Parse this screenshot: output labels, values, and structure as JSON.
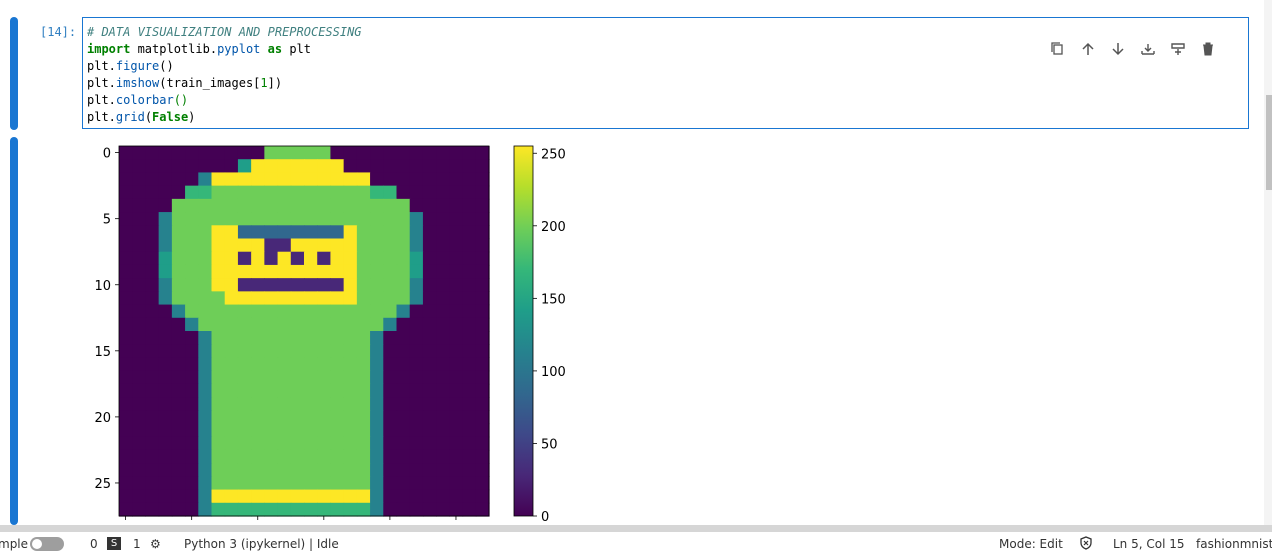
{
  "cell": {
    "prompt": "[14]:",
    "code": [
      [
        {
          "t": "# DATA VISUALIZATION AND PREPROCESSING",
          "c": "c-comment"
        }
      ],
      [
        {
          "t": "import",
          "c": "c-kw"
        },
        {
          "t": " matplotlib.",
          "c": "c-plain"
        },
        {
          "t": "pyplot",
          "c": "c-attr"
        },
        {
          "t": " ",
          "c": "c-plain"
        },
        {
          "t": "as",
          "c": "c-kw"
        },
        {
          "t": " plt",
          "c": "c-plain"
        }
      ],
      [
        {
          "t": "plt.",
          "c": "c-plain"
        },
        {
          "t": "figure",
          "c": "c-attr"
        },
        {
          "t": "()",
          "c": "c-plain"
        }
      ],
      [
        {
          "t": "plt.",
          "c": "c-plain"
        },
        {
          "t": "imshow",
          "c": "c-attr"
        },
        {
          "t": "(train_images[",
          "c": "c-plain"
        },
        {
          "t": "1",
          "c": "c-num"
        },
        {
          "t": "])",
          "c": "c-plain"
        }
      ],
      [
        {
          "t": "plt.",
          "c": "c-plain"
        },
        {
          "t": "colorbar",
          "c": "c-attr"
        },
        {
          "t": "()",
          "c": "c-num"
        }
      ],
      [
        {
          "t": "plt.",
          "c": "c-plain"
        },
        {
          "t": "grid",
          "c": "c-attr"
        },
        {
          "t": "(",
          "c": "c-plain"
        },
        {
          "t": "False",
          "c": "c-kw"
        },
        {
          "t": ")",
          "c": "c-plain"
        }
      ]
    ],
    "toolbar": [
      {
        "name": "copy-cell-icon"
      },
      {
        "name": "move-up-icon"
      },
      {
        "name": "move-down-icon"
      },
      {
        "name": "insert-above-icon"
      },
      {
        "name": "insert-below-icon"
      },
      {
        "name": "delete-cell-icon"
      }
    ]
  },
  "chart_data": {
    "type": "heatmap",
    "title": "",
    "xlabel": "",
    "ylabel": "",
    "y_ticks": [
      "0",
      "5",
      "10",
      "15",
      "20",
      "25"
    ],
    "colorbar_ticks": [
      "250",
      "200",
      "150",
      "100",
      "50",
      "0"
    ],
    "colorbar_range": [
      0,
      255
    ],
    "colormap": "viridis",
    "grid": false,
    "rows": 28,
    "cols": 28,
    "image_rows": [
      "0000000000077777000000000000",
      "0000000005999999900000000000",
      "0000004999999999999000000000",
      "0000066777777777777660000000",
      "0000777777777777777777000000",
      "0004777777777777777777400000",
      "0004777993333333397777400000",
      "0004777999911999997777400000",
      "0005777991919191997777500000",
      "0005777999999999997777500000",
      "0004777991111111197777400000",
      "0004777799999999997777400000",
      "0000477777777777777774000000",
      "0000047777777777777740000000",
      "0000004777777777777400000000",
      "0000004777777777777400000000",
      "0000004777777777777400000000",
      "0000004777777777777400000000",
      "0000004777777777777400000000",
      "0000004777777777777400000000",
      "0000004777777777777400000000",
      "0000004777777777777400000000",
      "0000004777777777777400000000",
      "0000004777777777777400000000",
      "0000004777777777777400000000",
      "0000004777777777777400000000",
      "0000004999999999999400000000",
      "0000004666666666666400000000"
    ]
  },
  "status": {
    "simple_label": "mple",
    "count0": "0",
    "count_s": "1",
    "kernel": "Python 3 (ipykernel) | Idle",
    "mode": "Mode: Edit",
    "position": "Ln 5, Col 15",
    "filename": "fashionmnist.",
    "s_badge": "S"
  },
  "colors": {
    "accent": "#1976d2",
    "viridis": [
      "#440154",
      "#482878",
      "#3e4989",
      "#31688e",
      "#26828e",
      "#1f9e89",
      "#35b779",
      "#6ece58",
      "#b5de2b",
      "#fde725"
    ]
  }
}
